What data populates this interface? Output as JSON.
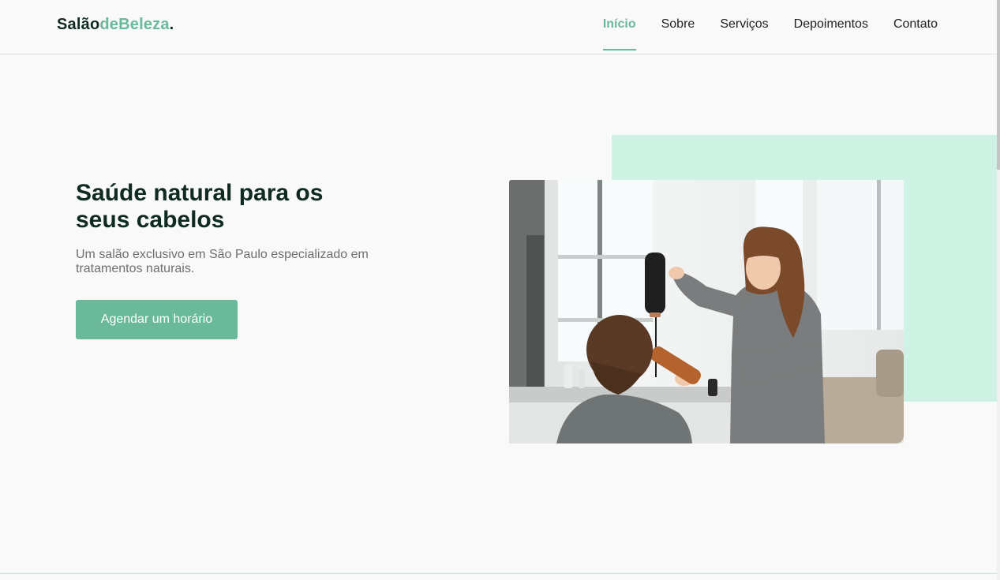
{
  "logo": {
    "part1": "Salão",
    "part2": "deBeleza",
    "dot": "."
  },
  "nav": {
    "items": [
      {
        "label": "Início",
        "active": true
      },
      {
        "label": "Sobre"
      },
      {
        "label": "Serviços"
      },
      {
        "label": "Depoimentos"
      },
      {
        "label": "Contato"
      }
    ]
  },
  "hero": {
    "title": "Saúde natural para os seus cabelos",
    "subtitle": "Um salão exclusivo em São Paulo especializado em tratamentos naturais.",
    "cta_label": "Agendar um horário",
    "image_alt": "hairdresser-drying-client-hair-photo"
  },
  "colors": {
    "accent": "#6ab99b",
    "mint": "#cef3e5",
    "heading": "#0f2a1f",
    "background": "#f9f9f9"
  }
}
